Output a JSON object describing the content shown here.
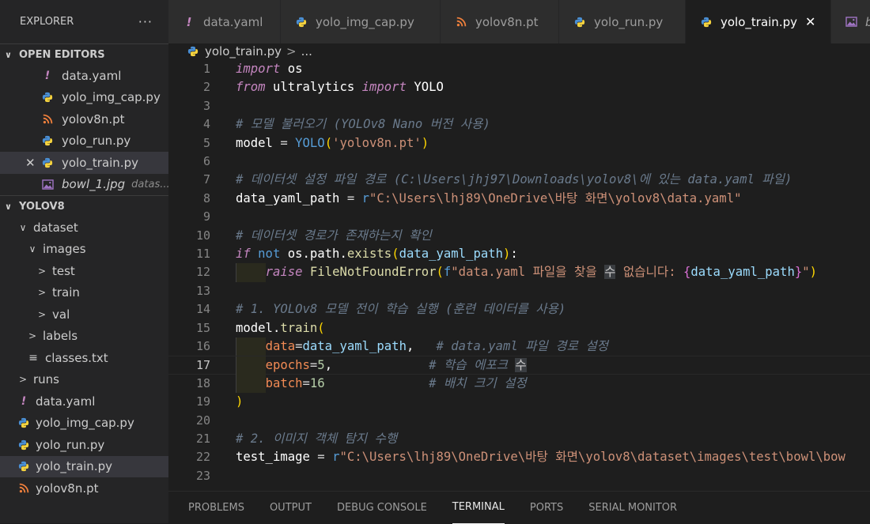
{
  "sidebar": {
    "title": "EXPLORER",
    "more": "···",
    "open_editors": {
      "title": "OPEN EDITORS",
      "items": [
        {
          "label": "data.yaml",
          "icon": "yaml-icon"
        },
        {
          "label": "yolo_img_cap.py",
          "icon": "python-icon"
        },
        {
          "label": "yolov8n.pt",
          "icon": "rss-icon"
        },
        {
          "label": "yolo_run.py",
          "icon": "python-icon"
        },
        {
          "label": "yolo_train.py",
          "icon": "python-icon",
          "selected": true,
          "close": "✕"
        },
        {
          "label": "bowl_1.jpg",
          "icon": "image-icon",
          "detail": "datas..."
        }
      ]
    },
    "project": {
      "title": "YOLOV8",
      "items": [
        {
          "label": "dataset",
          "indent": 1,
          "chev": "∨"
        },
        {
          "label": "images",
          "indent": 2,
          "chev": "∨"
        },
        {
          "label": "test",
          "indent": 3,
          "chev": ">"
        },
        {
          "label": "train",
          "indent": 3,
          "chev": ">"
        },
        {
          "label": "val",
          "indent": 3,
          "chev": ">"
        },
        {
          "label": "labels",
          "indent": 2,
          "chev": ">"
        },
        {
          "label": "classes.txt",
          "indent": 2,
          "icon": "list-icon"
        },
        {
          "label": "runs",
          "indent": 1,
          "chev": ">"
        },
        {
          "label": "data.yaml",
          "indent": 1,
          "icon": "yaml-icon"
        },
        {
          "label": "yolo_img_cap.py",
          "indent": 1,
          "icon": "python-icon"
        },
        {
          "label": "yolo_run.py",
          "indent": 1,
          "icon": "python-icon"
        },
        {
          "label": "yolo_train.py",
          "indent": 1,
          "icon": "python-icon",
          "selected": true
        },
        {
          "label": "yolov8n.pt",
          "indent": 1,
          "icon": "rss-icon"
        }
      ]
    }
  },
  "tabs": [
    {
      "label": "data.yaml",
      "icon": "yaml-icon"
    },
    {
      "label": "yolo_img_cap.py",
      "icon": "python-icon"
    },
    {
      "label": "yolov8n.pt",
      "icon": "rss-icon"
    },
    {
      "label": "yolo_run.py",
      "icon": "python-icon"
    },
    {
      "label": "yolo_train.py",
      "icon": "python-icon",
      "active": true,
      "close": "✕"
    },
    {
      "label": "bowl",
      "icon": "image-icon"
    }
  ],
  "breadcrumb": {
    "file": "yolo_train.py",
    "sep": ">",
    "rest": "..."
  },
  "editor": {
    "current_line": 17,
    "lines": [
      {
        "n": "1",
        "t": [
          [
            "kw",
            "import"
          ],
          [
            "id",
            " os"
          ]
        ]
      },
      {
        "n": "2",
        "t": [
          [
            "kw",
            "from"
          ],
          [
            "id",
            " ultralytics "
          ],
          [
            "kw",
            "import"
          ],
          [
            "id",
            " YOLO"
          ]
        ]
      },
      {
        "n": "3",
        "t": []
      },
      {
        "n": "4",
        "t": [
          [
            "cmt",
            "# 모델 불러오기 (YOLOv8 Nano 버전 사용)"
          ]
        ]
      },
      {
        "n": "5",
        "t": [
          [
            "id",
            "model "
          ],
          [
            "op",
            "= "
          ],
          [
            "kwb",
            "YOLO"
          ],
          [
            "par",
            "("
          ],
          [
            "str",
            "'yolov8n.pt'"
          ],
          [
            "par",
            ")"
          ]
        ]
      },
      {
        "n": "6",
        "t": []
      },
      {
        "n": "7",
        "t": [
          [
            "cmt",
            "# 데이터셋 설정 파일 경로 (C:\\Users\\jhj97\\Downloads\\yolov8\\에 있는 data.yaml 파일)"
          ]
        ]
      },
      {
        "n": "8",
        "t": [
          [
            "id",
            "data_yaml_path "
          ],
          [
            "op",
            "= "
          ],
          [
            "kwb",
            "r"
          ],
          [
            "strd",
            "\"C:\\Users\\lhj89\\OneDrive\\바탕 화면\\yolov8\\data.yaml\""
          ]
        ]
      },
      {
        "n": "9",
        "t": []
      },
      {
        "n": "10",
        "t": [
          [
            "cmt",
            "# 데이터셋 경로가 존재하는지 확인"
          ]
        ]
      },
      {
        "n": "11",
        "t": [
          [
            "kw",
            "if"
          ],
          [
            "id",
            " "
          ],
          [
            "kwb",
            "not"
          ],
          [
            "id",
            " os.path."
          ],
          [
            "fn",
            "exists"
          ],
          [
            "par",
            "("
          ],
          [
            "var",
            "data_yaml_path"
          ],
          [
            "par",
            ")"
          ],
          [
            "id",
            ":"
          ]
        ]
      },
      {
        "n": "12",
        "guide": true,
        "t": [
          [
            "id",
            "    "
          ],
          [
            "kw",
            "raise"
          ],
          [
            "id",
            " "
          ],
          [
            "fn",
            "FileNotFoundError"
          ],
          [
            "par",
            "("
          ],
          [
            "kwb",
            "f"
          ],
          [
            "strd",
            "\"data.yaml 파일을 찾을 "
          ],
          [
            "hl",
            "수"
          ],
          [
            "strd",
            " 없습니다: "
          ],
          [
            "par2",
            "{"
          ],
          [
            "var",
            "data_yaml_path"
          ],
          [
            "par2",
            "}"
          ],
          [
            "strd",
            "\""
          ],
          [
            "par",
            ")"
          ]
        ]
      },
      {
        "n": "13",
        "t": []
      },
      {
        "n": "14",
        "t": [
          [
            "cmt",
            "# 1. YOLOv8 모델 전이 학습 실행 (훈련 데이터를 사용)"
          ]
        ]
      },
      {
        "n": "15",
        "t": [
          [
            "id",
            "model."
          ],
          [
            "fn",
            "train"
          ],
          [
            "par",
            "("
          ]
        ]
      },
      {
        "n": "16",
        "guide": true,
        "t": [
          [
            "id",
            "    "
          ],
          [
            "param",
            "data"
          ],
          [
            "op",
            "="
          ],
          [
            "var",
            "data_yaml_path"
          ],
          [
            "id",
            ",   "
          ],
          [
            "cmt",
            "# data.yaml 파일 경로 설정"
          ]
        ]
      },
      {
        "n": "17",
        "guide": true,
        "t": [
          [
            "id",
            "    "
          ],
          [
            "param",
            "epochs"
          ],
          [
            "op",
            "="
          ],
          [
            "num",
            "5"
          ],
          [
            "id",
            ",             "
          ],
          [
            "cmt",
            "# 학습 에포크 "
          ],
          [
            "hl",
            "수"
          ]
        ]
      },
      {
        "n": "18",
        "guide": true,
        "t": [
          [
            "id",
            "    "
          ],
          [
            "param",
            "batch"
          ],
          [
            "op",
            "="
          ],
          [
            "num",
            "16"
          ],
          [
            "id",
            "              "
          ],
          [
            "cmt",
            "# 배치 크기 설정"
          ]
        ]
      },
      {
        "n": "19",
        "t": [
          [
            "par",
            ")"
          ]
        ]
      },
      {
        "n": "20",
        "t": []
      },
      {
        "n": "21",
        "t": [
          [
            "cmt",
            "# 2. 이미지 객체 탐지 수행"
          ]
        ]
      },
      {
        "n": "22",
        "t": [
          [
            "id",
            "test_image "
          ],
          [
            "op",
            "= "
          ],
          [
            "kwb",
            "r"
          ],
          [
            "strd",
            "\"C:\\Users\\lhj89\\OneDrive\\바탕 화면\\yolov8\\dataset\\images\\test\\bowl\\bow"
          ]
        ]
      },
      {
        "n": "23",
        "t": []
      }
    ]
  },
  "panel": {
    "tabs": [
      {
        "label": "PROBLEMS"
      },
      {
        "label": "OUTPUT"
      },
      {
        "label": "DEBUG CONSOLE"
      },
      {
        "label": "TERMINAL",
        "active": true
      },
      {
        "label": "PORTS"
      },
      {
        "label": "SERIAL MONITOR"
      }
    ]
  }
}
